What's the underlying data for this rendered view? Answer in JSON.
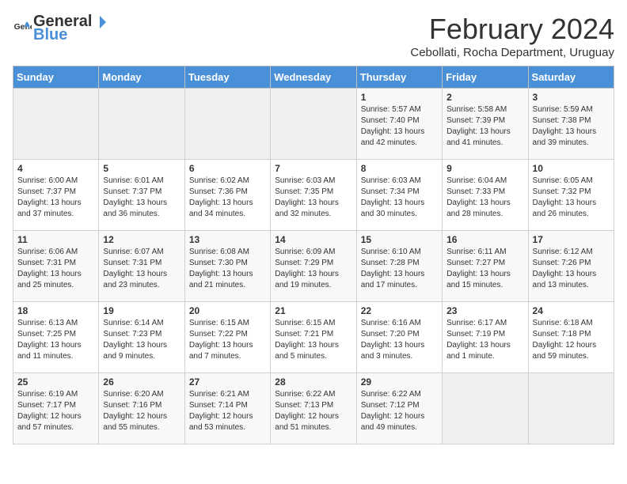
{
  "logo": {
    "text_general": "General",
    "text_blue": "Blue"
  },
  "title": "February 2024",
  "location": "Cebollati, Rocha Department, Uruguay",
  "days_of_week": [
    "Sunday",
    "Monday",
    "Tuesday",
    "Wednesday",
    "Thursday",
    "Friday",
    "Saturday"
  ],
  "weeks": [
    [
      {
        "day": "",
        "sunrise": "",
        "sunset": "",
        "daylight": ""
      },
      {
        "day": "",
        "sunrise": "",
        "sunset": "",
        "daylight": ""
      },
      {
        "day": "",
        "sunrise": "",
        "sunset": "",
        "daylight": ""
      },
      {
        "day": "",
        "sunrise": "",
        "sunset": "",
        "daylight": ""
      },
      {
        "day": "1",
        "sunrise": "Sunrise: 5:57 AM",
        "sunset": "Sunset: 7:40 PM",
        "daylight": "Daylight: 13 hours and 42 minutes."
      },
      {
        "day": "2",
        "sunrise": "Sunrise: 5:58 AM",
        "sunset": "Sunset: 7:39 PM",
        "daylight": "Daylight: 13 hours and 41 minutes."
      },
      {
        "day": "3",
        "sunrise": "Sunrise: 5:59 AM",
        "sunset": "Sunset: 7:38 PM",
        "daylight": "Daylight: 13 hours and 39 minutes."
      }
    ],
    [
      {
        "day": "4",
        "sunrise": "Sunrise: 6:00 AM",
        "sunset": "Sunset: 7:37 PM",
        "daylight": "Daylight: 13 hours and 37 minutes."
      },
      {
        "day": "5",
        "sunrise": "Sunrise: 6:01 AM",
        "sunset": "Sunset: 7:37 PM",
        "daylight": "Daylight: 13 hours and 36 minutes."
      },
      {
        "day": "6",
        "sunrise": "Sunrise: 6:02 AM",
        "sunset": "Sunset: 7:36 PM",
        "daylight": "Daylight: 13 hours and 34 minutes."
      },
      {
        "day": "7",
        "sunrise": "Sunrise: 6:03 AM",
        "sunset": "Sunset: 7:35 PM",
        "daylight": "Daylight: 13 hours and 32 minutes."
      },
      {
        "day": "8",
        "sunrise": "Sunrise: 6:03 AM",
        "sunset": "Sunset: 7:34 PM",
        "daylight": "Daylight: 13 hours and 30 minutes."
      },
      {
        "day": "9",
        "sunrise": "Sunrise: 6:04 AM",
        "sunset": "Sunset: 7:33 PM",
        "daylight": "Daylight: 13 hours and 28 minutes."
      },
      {
        "day": "10",
        "sunrise": "Sunrise: 6:05 AM",
        "sunset": "Sunset: 7:32 PM",
        "daylight": "Daylight: 13 hours and 26 minutes."
      }
    ],
    [
      {
        "day": "11",
        "sunrise": "Sunrise: 6:06 AM",
        "sunset": "Sunset: 7:31 PM",
        "daylight": "Daylight: 13 hours and 25 minutes."
      },
      {
        "day": "12",
        "sunrise": "Sunrise: 6:07 AM",
        "sunset": "Sunset: 7:31 PM",
        "daylight": "Daylight: 13 hours and 23 minutes."
      },
      {
        "day": "13",
        "sunrise": "Sunrise: 6:08 AM",
        "sunset": "Sunset: 7:30 PM",
        "daylight": "Daylight: 13 hours and 21 minutes."
      },
      {
        "day": "14",
        "sunrise": "Sunrise: 6:09 AM",
        "sunset": "Sunset: 7:29 PM",
        "daylight": "Daylight: 13 hours and 19 minutes."
      },
      {
        "day": "15",
        "sunrise": "Sunrise: 6:10 AM",
        "sunset": "Sunset: 7:28 PM",
        "daylight": "Daylight: 13 hours and 17 minutes."
      },
      {
        "day": "16",
        "sunrise": "Sunrise: 6:11 AM",
        "sunset": "Sunset: 7:27 PM",
        "daylight": "Daylight: 13 hours and 15 minutes."
      },
      {
        "day": "17",
        "sunrise": "Sunrise: 6:12 AM",
        "sunset": "Sunset: 7:26 PM",
        "daylight": "Daylight: 13 hours and 13 minutes."
      }
    ],
    [
      {
        "day": "18",
        "sunrise": "Sunrise: 6:13 AM",
        "sunset": "Sunset: 7:25 PM",
        "daylight": "Daylight: 13 hours and 11 minutes."
      },
      {
        "day": "19",
        "sunrise": "Sunrise: 6:14 AM",
        "sunset": "Sunset: 7:23 PM",
        "daylight": "Daylight: 13 hours and 9 minutes."
      },
      {
        "day": "20",
        "sunrise": "Sunrise: 6:15 AM",
        "sunset": "Sunset: 7:22 PM",
        "daylight": "Daylight: 13 hours and 7 minutes."
      },
      {
        "day": "21",
        "sunrise": "Sunrise: 6:15 AM",
        "sunset": "Sunset: 7:21 PM",
        "daylight": "Daylight: 13 hours and 5 minutes."
      },
      {
        "day": "22",
        "sunrise": "Sunrise: 6:16 AM",
        "sunset": "Sunset: 7:20 PM",
        "daylight": "Daylight: 13 hours and 3 minutes."
      },
      {
        "day": "23",
        "sunrise": "Sunrise: 6:17 AM",
        "sunset": "Sunset: 7:19 PM",
        "daylight": "Daylight: 13 hours and 1 minute."
      },
      {
        "day": "24",
        "sunrise": "Sunrise: 6:18 AM",
        "sunset": "Sunset: 7:18 PM",
        "daylight": "Daylight: 12 hours and 59 minutes."
      }
    ],
    [
      {
        "day": "25",
        "sunrise": "Sunrise: 6:19 AM",
        "sunset": "Sunset: 7:17 PM",
        "daylight": "Daylight: 12 hours and 57 minutes."
      },
      {
        "day": "26",
        "sunrise": "Sunrise: 6:20 AM",
        "sunset": "Sunset: 7:16 PM",
        "daylight": "Daylight: 12 hours and 55 minutes."
      },
      {
        "day": "27",
        "sunrise": "Sunrise: 6:21 AM",
        "sunset": "Sunset: 7:14 PM",
        "daylight": "Daylight: 12 hours and 53 minutes."
      },
      {
        "day": "28",
        "sunrise": "Sunrise: 6:22 AM",
        "sunset": "Sunset: 7:13 PM",
        "daylight": "Daylight: 12 hours and 51 minutes."
      },
      {
        "day": "29",
        "sunrise": "Sunrise: 6:22 AM",
        "sunset": "Sunset: 7:12 PM",
        "daylight": "Daylight: 12 hours and 49 minutes."
      },
      {
        "day": "",
        "sunrise": "",
        "sunset": "",
        "daylight": ""
      },
      {
        "day": "",
        "sunrise": "",
        "sunset": "",
        "daylight": ""
      }
    ]
  ]
}
